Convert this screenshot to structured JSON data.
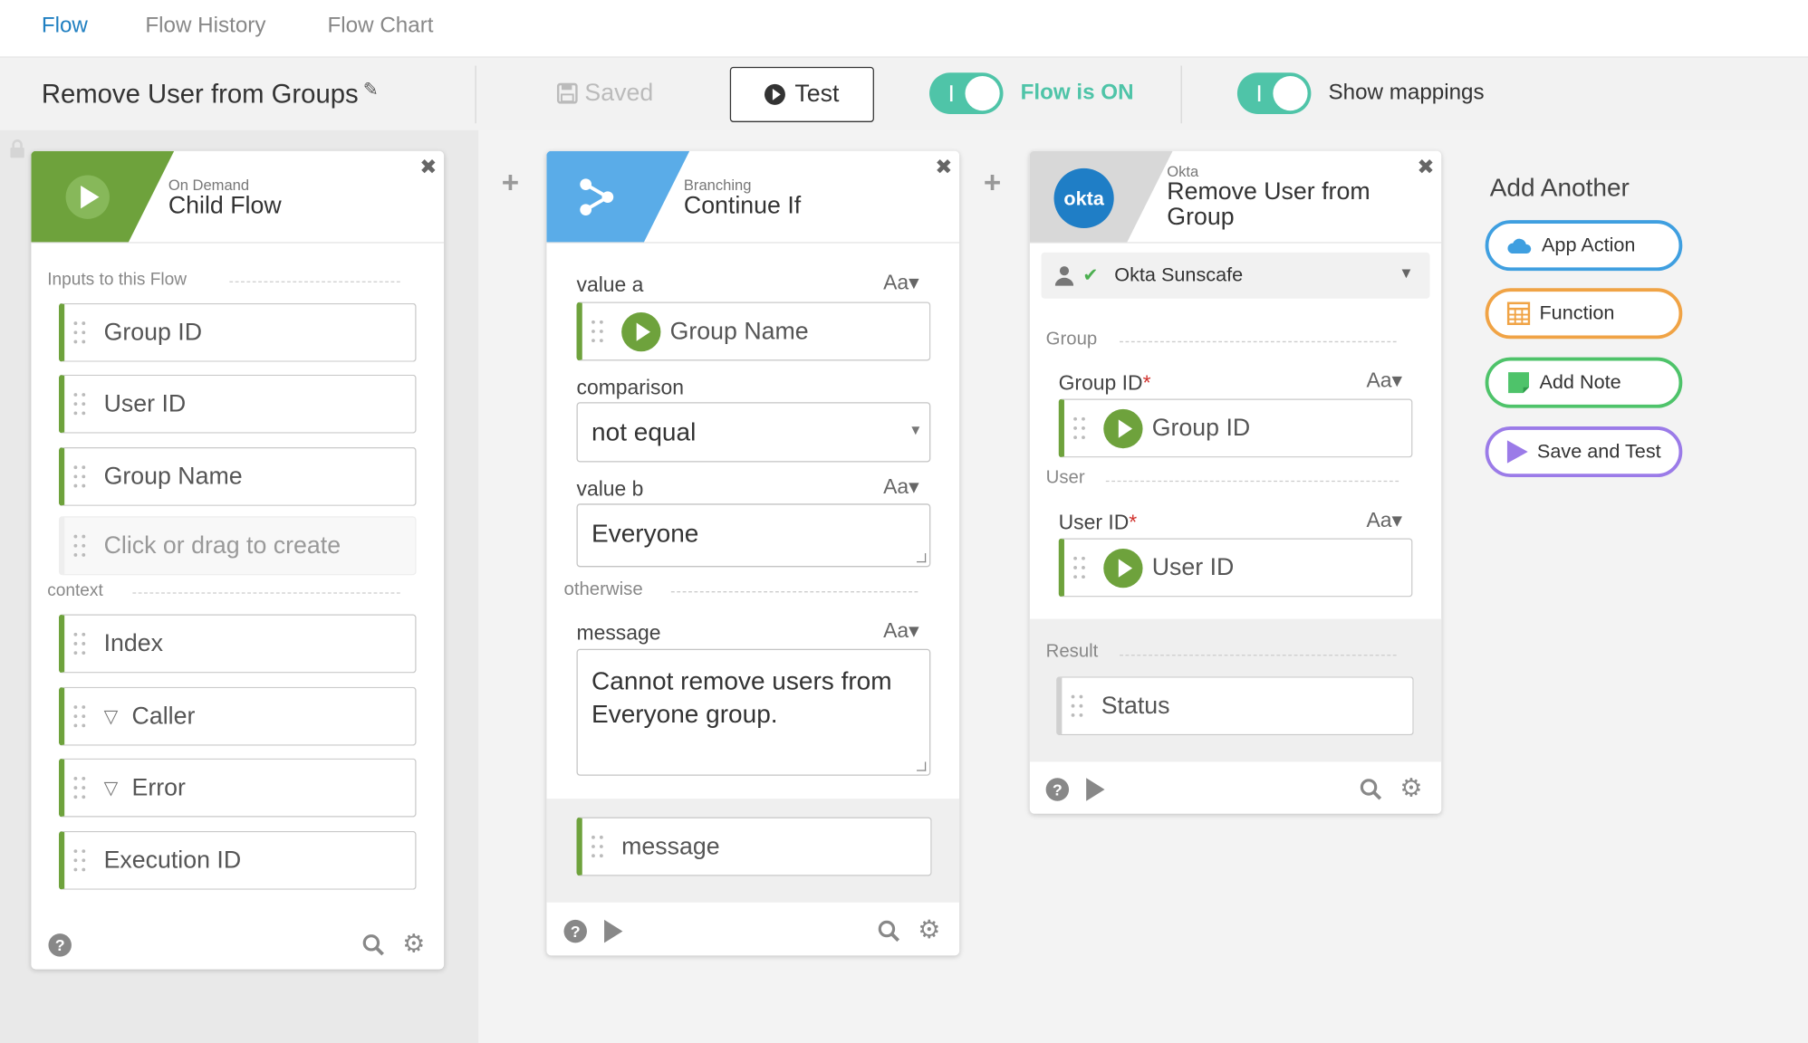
{
  "tabs": [
    {
      "label": "Flow",
      "active": true
    },
    {
      "label": "Flow History",
      "active": false
    },
    {
      "label": "Flow Chart",
      "active": false
    }
  ],
  "toolbar": {
    "flow_title": "Remove User from Groups",
    "saved_label": "Saved",
    "test_label": "Test",
    "flow_toggle_label": "Flow is ON",
    "mappings_toggle_label": "Show mappings"
  },
  "colors": {
    "accent_green": "#6ea23c",
    "toggle_teal": "#4fc4a8",
    "branch_blue": "#5aace8",
    "okta_blue": "#1f7ec6",
    "tab_active": "#1f7fc1"
  },
  "card1": {
    "subtitle": "On Demand",
    "title": "Child Flow",
    "inputs_label": "Inputs to this Flow",
    "inputs": [
      "Group ID",
      "User ID",
      "Group Name"
    ],
    "create_placeholder": "Click or drag to create",
    "context_label": "context",
    "context_items": [
      "Index",
      "Caller",
      "Error",
      "Execution ID"
    ]
  },
  "card2": {
    "subtitle": "Branching",
    "title": "Continue If",
    "value_a_label": "value a",
    "value_a": "Group Name",
    "comparison_label": "comparison",
    "comparison_value": "not equal",
    "value_b_label": "value b",
    "value_b": "Everyone",
    "otherwise_label": "otherwise",
    "message_label": "message",
    "message_value": "Cannot remove users from Everyone group.",
    "output": "message",
    "aa": "Aa"
  },
  "card3": {
    "subtitle": "Okta",
    "title": "Remove User from Group",
    "logo_text": "okta",
    "connection": "Okta Sunscafe",
    "group_section": "Group",
    "group_id_label": "Group ID",
    "group_id_value": "Group ID",
    "user_section": "User",
    "user_id_label": "User ID",
    "user_id_value": "User ID",
    "required_mark": "*",
    "result_label": "Result",
    "result_value": "Status"
  },
  "add_another": {
    "title": "Add Another",
    "buttons": [
      {
        "label": "App Action",
        "color": "#3f9fe0"
      },
      {
        "label": "Function",
        "color": "#f0a345"
      },
      {
        "label": "Add Note",
        "color": "#4ec36a"
      },
      {
        "label": "Save and Test",
        "color": "#9b7be8"
      }
    ]
  }
}
